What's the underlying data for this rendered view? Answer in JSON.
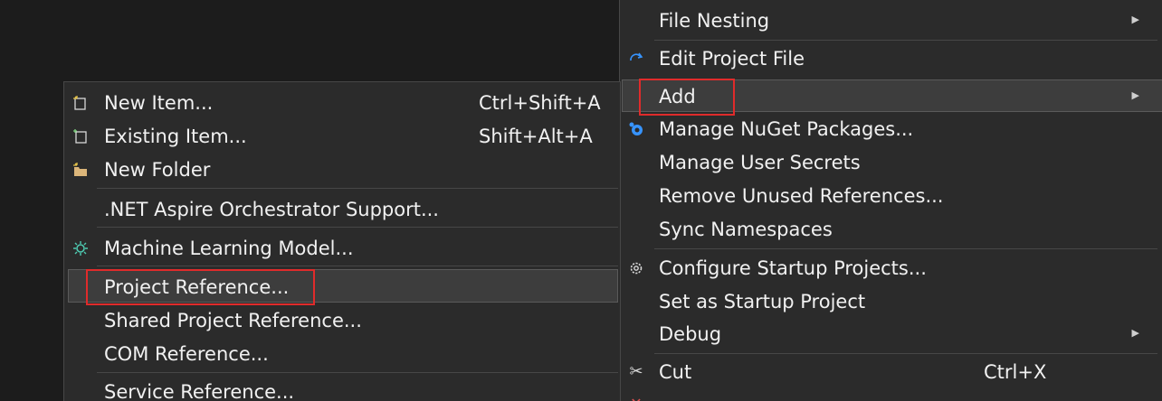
{
  "context_menu": {
    "items": [
      {
        "label": "File Nesting"
      },
      {
        "label": "Edit Project File"
      },
      {
        "label": "Add"
      },
      {
        "label": "Manage NuGet Packages..."
      },
      {
        "label": "Manage User Secrets"
      },
      {
        "label": "Remove Unused References..."
      },
      {
        "label": "Sync Namespaces"
      },
      {
        "label": "Configure Startup Projects..."
      },
      {
        "label": "Set as Startup Project"
      },
      {
        "label": "Debug"
      },
      {
        "label": "Cut",
        "shortcut": "Ctrl+X"
      }
    ]
  },
  "add_submenu": {
    "items": [
      {
        "label": "New Item...",
        "shortcut": "Ctrl+Shift+A"
      },
      {
        "label": "Existing Item...",
        "shortcut": "Shift+Alt+A"
      },
      {
        "label": "New Folder"
      },
      {
        "label": ".NET Aspire Orchestrator Support..."
      },
      {
        "label": "Machine Learning Model..."
      },
      {
        "label": "Project Reference..."
      },
      {
        "label": "Shared Project Reference..."
      },
      {
        "label": "COM Reference..."
      },
      {
        "label": "Service Reference..."
      }
    ]
  },
  "colors": {
    "background": "#1c1c1c",
    "menu_bg": "#2b2b2b",
    "menu_text": "#f1f1f1",
    "highlight_box": "#e02b2b",
    "accent_blue": "#3794ff"
  }
}
